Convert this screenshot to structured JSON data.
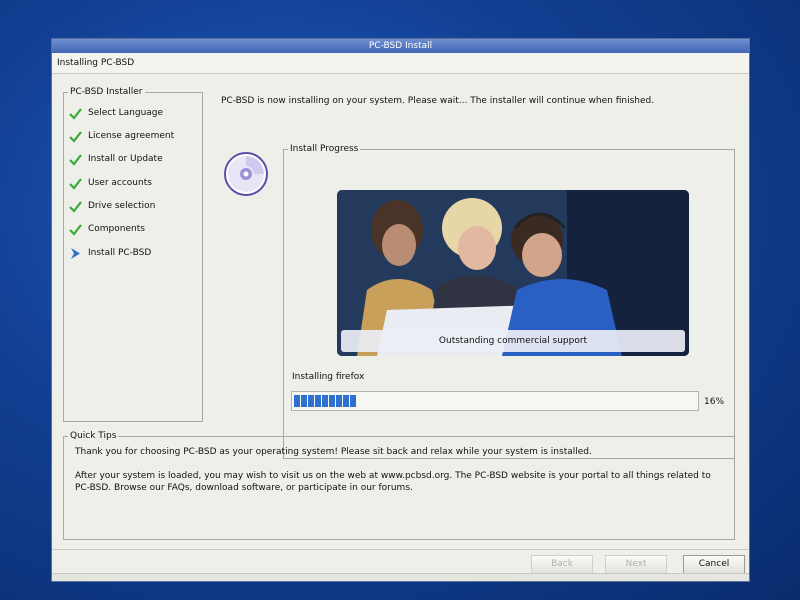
{
  "window": {
    "title": "PC-BSD Install",
    "header": "Installing PC-BSD"
  },
  "steps": {
    "legend": "PC-BSD Installer",
    "items": [
      {
        "label": "Select Language",
        "state": "done"
      },
      {
        "label": "License agreement",
        "state": "done"
      },
      {
        "label": "Install or Update",
        "state": "done"
      },
      {
        "label": "User accounts",
        "state": "done"
      },
      {
        "label": "Drive selection",
        "state": "done"
      },
      {
        "label": "Components",
        "state": "done"
      },
      {
        "label": "Install PC-BSD",
        "state": "current"
      }
    ]
  },
  "main": {
    "status_message": "PC-BSD is now installing on your system. Please wait... The installer will continue when finished."
  },
  "progress": {
    "legend": "Install Progress",
    "slide_caption": "Outstanding commercial support",
    "current_task": "Installing firefox",
    "percent_text": "16%",
    "percent": 16
  },
  "tips": {
    "legend": "Quick Tips",
    "line1": "Thank you for choosing PC-BSD as your operating system! Please sit back and relax while your system is installed.",
    "line2": "After your system is loaded, you may wish to visit us on the web at www.pcbsd.org. The PC-BSD website is your portal to all things related to PC-BSD. Browse our FAQs, download software, or participate in our forums."
  },
  "buttons": {
    "back": "Back",
    "next": "Next",
    "cancel": "Cancel"
  },
  "colors": {
    "accent": "#2f6fd0",
    "check": "#3aa83a",
    "titlebar": "#4166b3"
  }
}
